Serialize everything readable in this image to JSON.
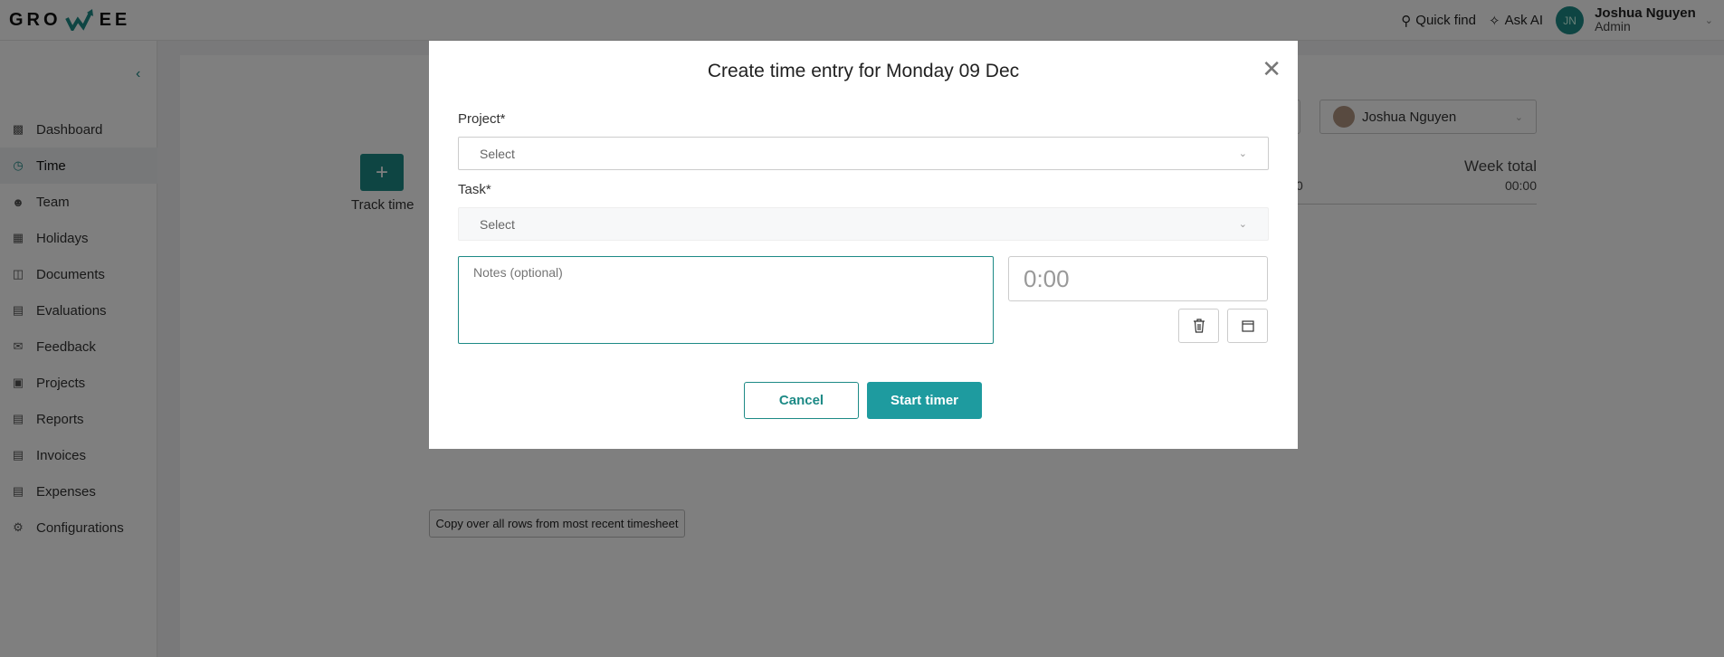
{
  "header": {
    "logo": "GROWEE",
    "quick_find": "Quick find",
    "ask_ai": "Ask AI",
    "user_initials": "JN",
    "user_name": "Joshua Nguyen",
    "user_role": "Admin"
  },
  "sidebar": {
    "items": [
      {
        "label": "Dashboard",
        "icon": "bar-chart-icon"
      },
      {
        "label": "Time",
        "icon": "clock-icon",
        "active": true
      },
      {
        "label": "Team",
        "icon": "team-icon"
      },
      {
        "label": "Holidays",
        "icon": "calendar-icon"
      },
      {
        "label": "Documents",
        "icon": "documents-icon"
      },
      {
        "label": "Evaluations",
        "icon": "evaluations-icon"
      },
      {
        "label": "Feedback",
        "icon": "feedback-icon"
      },
      {
        "label": "Projects",
        "icon": "projects-icon"
      },
      {
        "label": "Reports",
        "icon": "reports-icon"
      },
      {
        "label": "Invoices",
        "icon": "invoices-icon"
      },
      {
        "label": "Expenses",
        "icon": "expenses-icon"
      },
      {
        "label": "Configurations",
        "icon": "gear-icon"
      }
    ]
  },
  "main": {
    "track_time": "Track time",
    "user_select": "Joshua Nguyen",
    "day_total": "0",
    "week_total_label": "Week total",
    "week_total_value": "00:00",
    "copy_button": "Copy over all rows from most recent timesheet"
  },
  "modal": {
    "title": "Create time entry for Monday 09 Dec",
    "project_label": "Project*",
    "project_placeholder": "Select",
    "task_label": "Task*",
    "task_placeholder": "Select",
    "notes_placeholder": "Notes (optional)",
    "time_placeholder": "0:00",
    "cancel": "Cancel",
    "start_timer": "Start timer"
  },
  "colors": {
    "accent": "#1d8a86",
    "button": "#1e9b9f"
  }
}
